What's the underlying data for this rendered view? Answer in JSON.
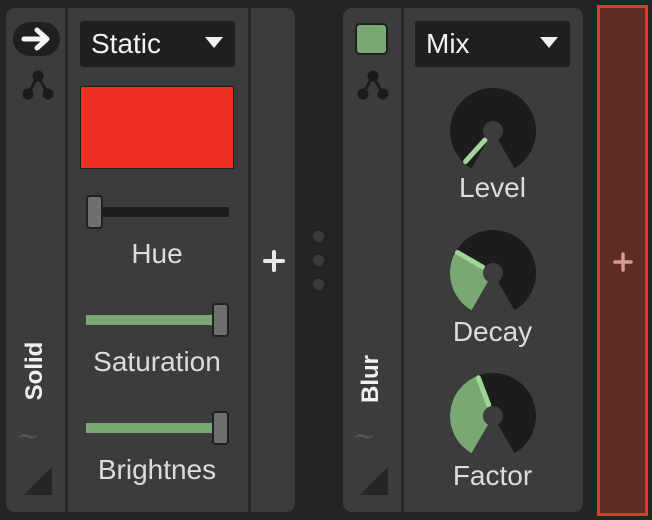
{
  "colors": {
    "background": "#242424",
    "device": "#3c3c3c",
    "swatch": "#ee3024",
    "slider_fill": "#78a873",
    "knob_fill": "#7aa874",
    "drop_zone_fill": "#5d2c26",
    "drop_zone_border": "#e23b25"
  },
  "devices": [
    {
      "title": "Solid",
      "mode_dropdown": {
        "selected": "Static"
      },
      "icons": [
        "arrow-right-icon",
        "routing-nodes-icon",
        "modulation-wave-icon",
        "resize-corner-icon"
      ],
      "controls": {
        "hue": {
          "label": "Hue",
          "value": 0.0
        },
        "saturation": {
          "label": "Saturation",
          "value": 1.0
        },
        "brightness": {
          "label": "Brightnes",
          "value": 1.0
        }
      }
    },
    {
      "title": "Blur",
      "mode_dropdown": {
        "selected": "Mix"
      },
      "icons": [
        "enabled-square-icon",
        "routing-nodes-icon",
        "modulation-wave-icon",
        "resize-corner-icon"
      ],
      "knobs": [
        {
          "label": "Level",
          "value": 0.04
        },
        {
          "label": "Decay",
          "value": 0.3
        },
        {
          "label": "Factor",
          "value": 0.43
        }
      ]
    }
  ],
  "add_device_icon": "plus-icon",
  "drop_zone_icon": "plus-icon"
}
